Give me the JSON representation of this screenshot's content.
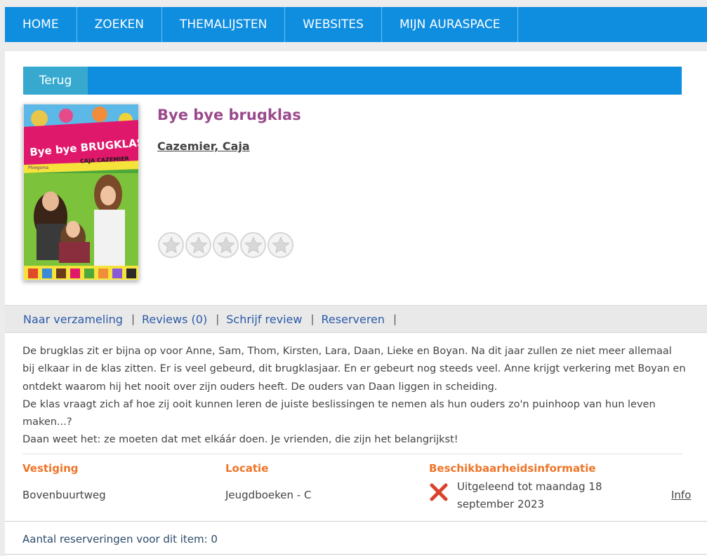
{
  "nav": {
    "items": [
      "HOME",
      "ZOEKEN",
      "THEMALIJSTEN",
      "WEBSITES",
      "MIJN AURASPACE"
    ]
  },
  "back_label": "Terug",
  "book": {
    "title": "Bye bye brugklas",
    "author": "Cazemier, Caja",
    "cover": {
      "title_text": "Bye bye BRUGKLAS",
      "author_text": "CAJA CAZEMIER",
      "publisher_text": "Ploegsma"
    },
    "rating": {
      "value": 0,
      "max": 5
    }
  },
  "actions": [
    "Naar verzameling",
    "Reviews (0)",
    "Schrijf review",
    "Reserveren"
  ],
  "action_separator": "|",
  "description": [
    "De brugklas zit er bijna op voor Anne, Sam, Thom, Kirsten, Lara, Daan, Lieke en Boyan. Na dit jaar zullen ze niet meer allemaal bij elkaar in de klas zitten. Er is veel gebeurd, dit brugklasjaar. En er gebeurt nog steeds veel. Anne krijgt verkering met Boyan en ontdekt waarom hij het nooit over zijn ouders heeft. De ouders van Daan liggen in scheiding.",
    "De klas vraagt zich af hoe zij ooit kunnen leren de juiste beslissingen te nemen als hun ouders zo'n puinhoop van hun leven maken...?",
    "Daan weet het: ze moeten dat met elkáár doen. Je vrienden, die zijn het belangrijkst!"
  ],
  "availability": {
    "headers": {
      "branch": "Vestiging",
      "location": "Locatie",
      "status": "Beschikbaarheidsinformatie"
    },
    "row": {
      "branch": "Bovenbuurtweg",
      "location": "Jeugdboeken - C",
      "status": "Uitgeleend tot maandag 18 september 2023",
      "info": "Info"
    }
  },
  "reservations_text": "Aantal reserveringen voor dit item: 0",
  "colors": {
    "nav_bg": "#0f8ee0",
    "back_button": "#37a9cf",
    "title": "#9a4a8c",
    "header_orange": "#ee7528",
    "link_blue": "#2b5aa8",
    "unavailable_red": "#d9432b"
  },
  "icons": {
    "status": "x-mark-icon",
    "star": "star-icon"
  }
}
